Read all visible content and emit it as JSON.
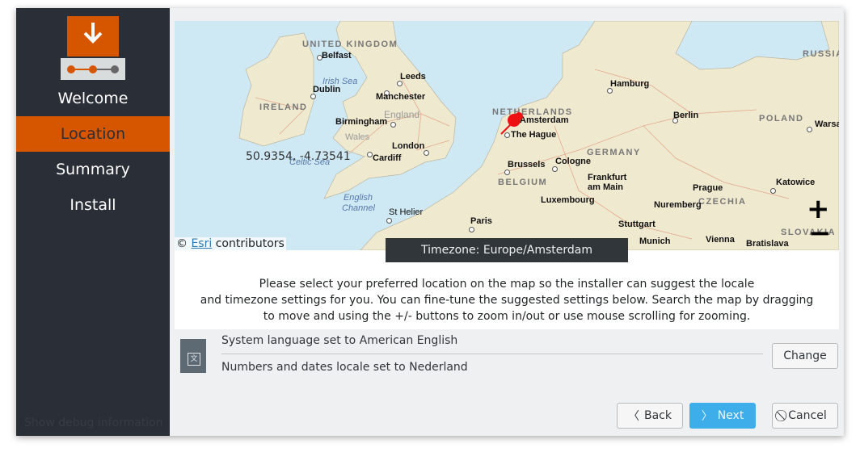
{
  "sidebar": {
    "steps": [
      "Welcome",
      "Location",
      "Summary",
      "Install"
    ],
    "active": "Location",
    "debug": "Show debug information"
  },
  "map": {
    "cities": [
      "Belfast",
      "Leeds",
      "Dublin",
      "Manchester",
      "Birmingham",
      "London",
      "Cardiff",
      "St Helier",
      "Paris",
      "Amsterdam",
      "The Hague",
      "Brussels",
      "Cologne",
      "Luxembourg",
      "Frankfurt am Main",
      "Stuttgart",
      "Munich",
      "Nuremberg",
      "Hamburg",
      "Berlin",
      "Prague",
      "Vienna",
      "Bratislava",
      "Katowice",
      "Warsa"
    ],
    "countries": [
      "UNITED KINGDOM",
      "IRELAND",
      "NETHERLANDS",
      "GERMANY",
      "BELGIUM",
      "POLAND",
      "CZECHIA",
      "SLOVAKIA",
      "RUSSIA"
    ],
    "seas": [
      "Irish Sea",
      "Celtic Sea",
      "English Channel"
    ],
    "regions": [
      "England",
      "Wales"
    ],
    "coordinates": "50.9354, -4.73541",
    "attribution_prefix": "©",
    "attribution_link": "Esri",
    "attribution_suffix": "contributors",
    "zoom_in": "+",
    "zoom_out": "−",
    "pin_color": "#ee1111"
  },
  "timezone_label": "Timezone: Europe/Amsterdam",
  "description": [
    "Please select your preferred location on the map so the installer can suggest the locale",
    "and timezone settings for you. You can fine-tune the suggested settings below. Search the map by dragging",
    "to move and using the +/- buttons to zoom in/out or use mouse scrolling for zooming."
  ],
  "locale": {
    "language": "System language set to American English",
    "formats": "Numbers and dates locale set to Nederland",
    "change": "Change"
  },
  "buttons": {
    "back": "Back",
    "next": "Next",
    "cancel": "Cancel"
  },
  "colors": {
    "accent": "#d65600",
    "sidebar": "#2a2e36",
    "primary": "#3daee9"
  }
}
